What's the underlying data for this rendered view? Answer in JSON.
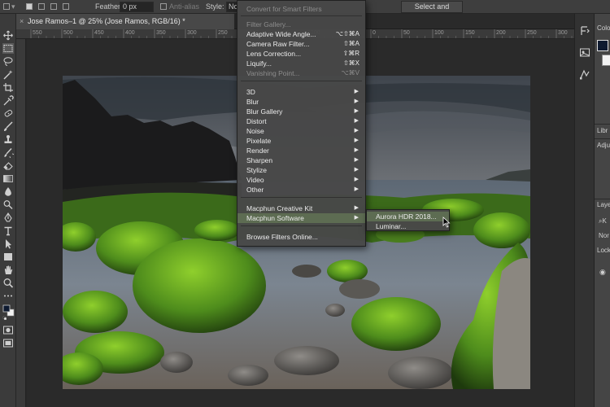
{
  "options_bar": {
    "feather_label": "Feather:",
    "feather_value": "0 px",
    "antialias_label": "Anti-alias",
    "style_label": "Style:",
    "style_value": "No",
    "select_mask_button": "Select and Mask..."
  },
  "document_tab": {
    "title": "Jose Ramos–1 @ 25% (Jose Ramos, RGB/16) *",
    "close_glyph": "×"
  },
  "ruler": {
    "labels": [
      "550",
      "500",
      "450",
      "400",
      "350",
      "300",
      "250",
      "200",
      "150",
      "100",
      "50",
      "0",
      "50",
      "100",
      "150",
      "200",
      "250",
      "300"
    ]
  },
  "filter_menu": {
    "items": [
      {
        "label": "Convert for Smart Filters",
        "disabled": true,
        "shortcut": ""
      },
      {
        "label": "Filter Gallery...",
        "disabled": true,
        "shortcut": ""
      },
      {
        "label": "Adaptive Wide Angle...",
        "disabled": false,
        "shortcut": "⌥⇧⌘A"
      },
      {
        "label": "Camera Raw Filter...",
        "disabled": false,
        "shortcut": "⇧⌘A"
      },
      {
        "label": "Lens Correction...",
        "disabled": false,
        "shortcut": "⇧⌘R"
      },
      {
        "label": "Liquify...",
        "disabled": false,
        "shortcut": "⇧⌘X"
      },
      {
        "label": "Vanishing Point...",
        "disabled": true,
        "shortcut": "⌥⌘V"
      },
      {
        "label": "3D",
        "disabled": false,
        "shortcut": ""
      },
      {
        "label": "Blur",
        "disabled": false,
        "shortcut": ""
      },
      {
        "label": "Blur Gallery",
        "disabled": false,
        "shortcut": ""
      },
      {
        "label": "Distort",
        "disabled": false,
        "shortcut": ""
      },
      {
        "label": "Noise",
        "disabled": false,
        "shortcut": ""
      },
      {
        "label": "Pixelate",
        "disabled": false,
        "shortcut": ""
      },
      {
        "label": "Render",
        "disabled": false,
        "shortcut": ""
      },
      {
        "label": "Sharpen",
        "disabled": false,
        "shortcut": ""
      },
      {
        "label": "Stylize",
        "disabled": false,
        "shortcut": ""
      },
      {
        "label": "Video",
        "disabled": false,
        "shortcut": ""
      },
      {
        "label": "Other",
        "disabled": false,
        "shortcut": ""
      },
      {
        "label": "Macphun Creative Kit",
        "disabled": false,
        "shortcut": ""
      },
      {
        "label": "Macphun Software",
        "disabled": false,
        "shortcut": "",
        "highlighted": true
      },
      {
        "label": "Browse Filters Online...",
        "disabled": false,
        "shortcut": ""
      }
    ],
    "submenu_arrow": "▶"
  },
  "submenu": {
    "items": [
      {
        "label": "Aurora HDR 2018...",
        "highlighted": true
      },
      {
        "label": "Luminar..."
      }
    ]
  },
  "right_panel": {
    "color_label": "Colo",
    "libraries_label": "Libr",
    "adjustments_label": "Adju",
    "layers_label": "Laye",
    "kind_label": "K",
    "blend_label": "Nor",
    "lock_label": "Lock"
  },
  "colors": {
    "menu_highlight": "#5d6c52",
    "app_background": "#282828",
    "menu_background": "#484848"
  }
}
